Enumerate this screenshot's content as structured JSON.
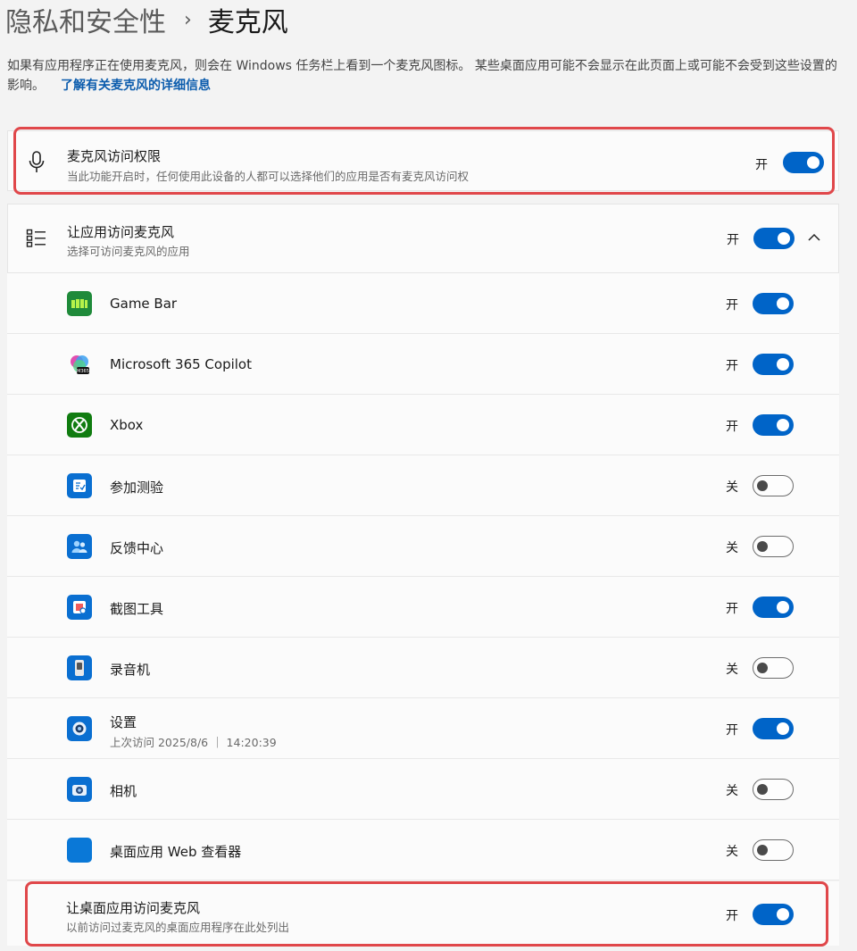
{
  "breadcrumb": {
    "parent": "隐私和安全性",
    "separator": "›",
    "current": "麦克风"
  },
  "description": {
    "text": "如果有应用程序正在使用麦克风，则会在 Windows 任务栏上看到一个麦克风图标。 某些桌面应用可能不会显示在此页面上或可能不会受到这些设置的影响。",
    "link": "了解有关麦克风的详细信息"
  },
  "mic_access": {
    "title": "麦克风访问权限",
    "subtitle": "当此功能开启时，任何使用此设备的人都可以选择他们的应用是否有麦克风访问权",
    "state": "开",
    "on": true,
    "icon": "microphone-icon"
  },
  "app_access": {
    "title": "让应用访问麦克风",
    "subtitle": "选择可访问麦克风的应用",
    "state": "开",
    "on": true,
    "icon": "list-icon",
    "expand_icon": "chevron-up-icon"
  },
  "apps": [
    {
      "name": "Game Bar",
      "state": "开",
      "on": true,
      "icon": "game-bar-icon",
      "color": "#1f8a3a"
    },
    {
      "name": "Microsoft 365 Copilot",
      "state": "开",
      "on": true,
      "icon": "m365-copilot-icon",
      "color": "#7a5cf0"
    },
    {
      "name": "Xbox",
      "state": "开",
      "on": true,
      "icon": "xbox-icon",
      "color": "#107c10"
    },
    {
      "name": "参加测验",
      "state": "关",
      "on": false,
      "icon": "take-a-test-icon",
      "color": "#0a6fd1"
    },
    {
      "name": "反馈中心",
      "state": "关",
      "on": false,
      "icon": "feedback-hub-icon",
      "color": "#0a6fd1"
    },
    {
      "name": "截图工具",
      "state": "开",
      "on": true,
      "icon": "snipping-tool-icon",
      "color": "#0a6fd1"
    },
    {
      "name": "录音机",
      "state": "关",
      "on": false,
      "icon": "sound-recorder-icon",
      "color": "#0a6fd1"
    },
    {
      "name": "设置",
      "sub": "上次访问 2025/8/6 ｜ 14:20:39",
      "state": "开",
      "on": true,
      "icon": "settings-gear-icon",
      "color": "#0a6fd1"
    },
    {
      "name": "相机",
      "state": "关",
      "on": false,
      "icon": "camera-icon",
      "color": "#0a6fd1"
    },
    {
      "name": "桌面应用 Web 查看器",
      "state": "关",
      "on": false,
      "icon": "web-viewer-icon",
      "color": "#0a78d7"
    }
  ],
  "desktop_access": {
    "title": "让桌面应用访问麦克风",
    "subtitle": "以前访问过麦克风的桌面应用程序在此处列出",
    "state": "开",
    "on": true
  },
  "colors": {
    "accent": "#0064c8",
    "highlight": "#e0474a",
    "link": "#0b5cad"
  }
}
